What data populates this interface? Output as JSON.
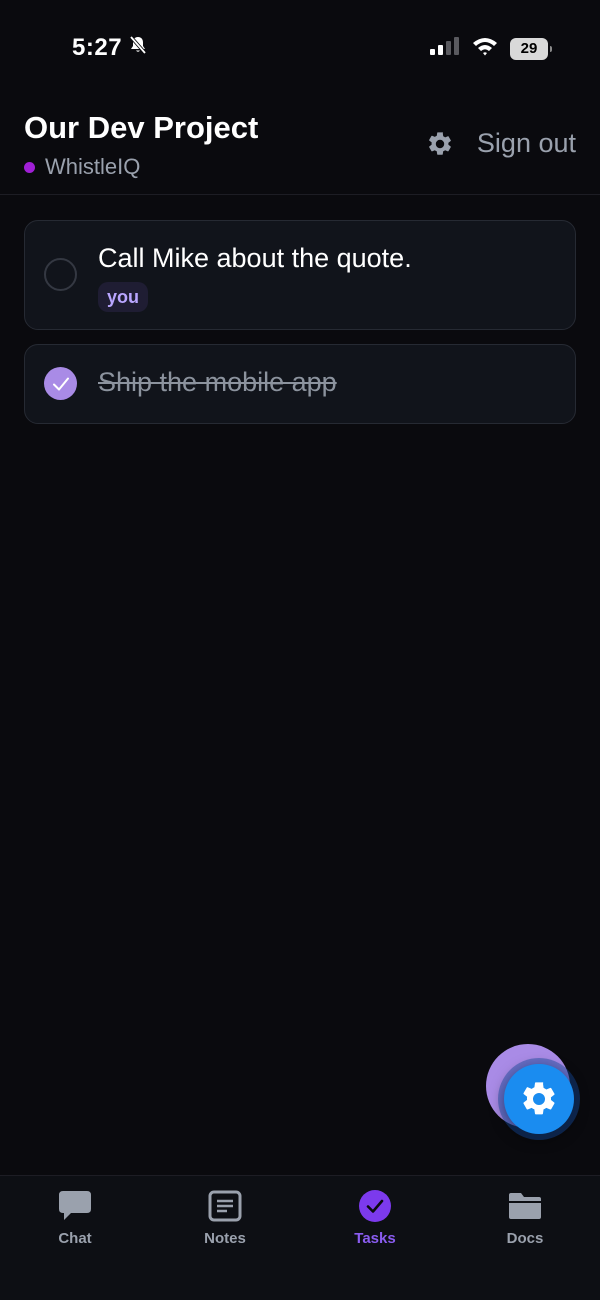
{
  "status_bar": {
    "time": "5:27",
    "battery": "29"
  },
  "header": {
    "title": "Our Dev Project",
    "workspace": "WhistleIQ",
    "sign_out_label": "Sign out"
  },
  "tasks": [
    {
      "text": "Call Mike about the quote.",
      "assignee": "you",
      "completed": false
    },
    {
      "text": "Ship the mobile app",
      "completed": true
    }
  ],
  "tab_bar": {
    "active": "Tasks",
    "tabs": [
      {
        "label": "Chat",
        "icon": "chat-bubble-icon"
      },
      {
        "label": "Notes",
        "icon": "notes-icon"
      },
      {
        "label": "Tasks",
        "icon": "check-circle-icon"
      },
      {
        "label": "Docs",
        "icon": "folder-icon"
      }
    ]
  },
  "colors": {
    "background": "#0a0a0e",
    "card": "#11141b",
    "accent": "#8a5cf0",
    "check_done": "#a98be6",
    "fab": "#1a8cf0",
    "workspace_dot": "#a01fd6",
    "muted_text": "#9aa1ad"
  }
}
